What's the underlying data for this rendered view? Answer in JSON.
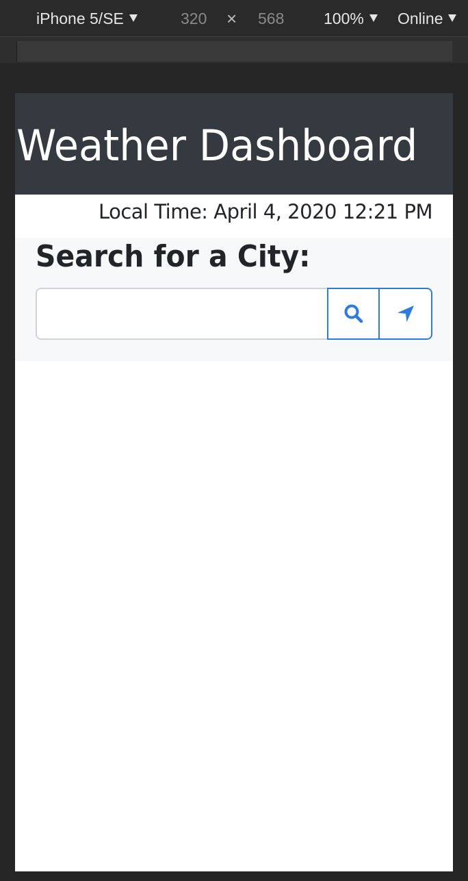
{
  "devtools": {
    "device": "iPhone 5/SE",
    "width": "320",
    "times": "×",
    "height": "568",
    "zoom": "100%",
    "network": "Online"
  },
  "header": {
    "title": "Weather Dashboard"
  },
  "local_time": "Local Time: April 4, 2020 12:21 PM",
  "search": {
    "heading": "Search for a City:",
    "value": "",
    "placeholder": ""
  },
  "icons": {
    "search": "search-icon",
    "location": "location-arrow-icon"
  },
  "colors": {
    "header_bg": "#343a40",
    "accent": "#2a7be4",
    "search_bg": "#f7f8fa"
  }
}
